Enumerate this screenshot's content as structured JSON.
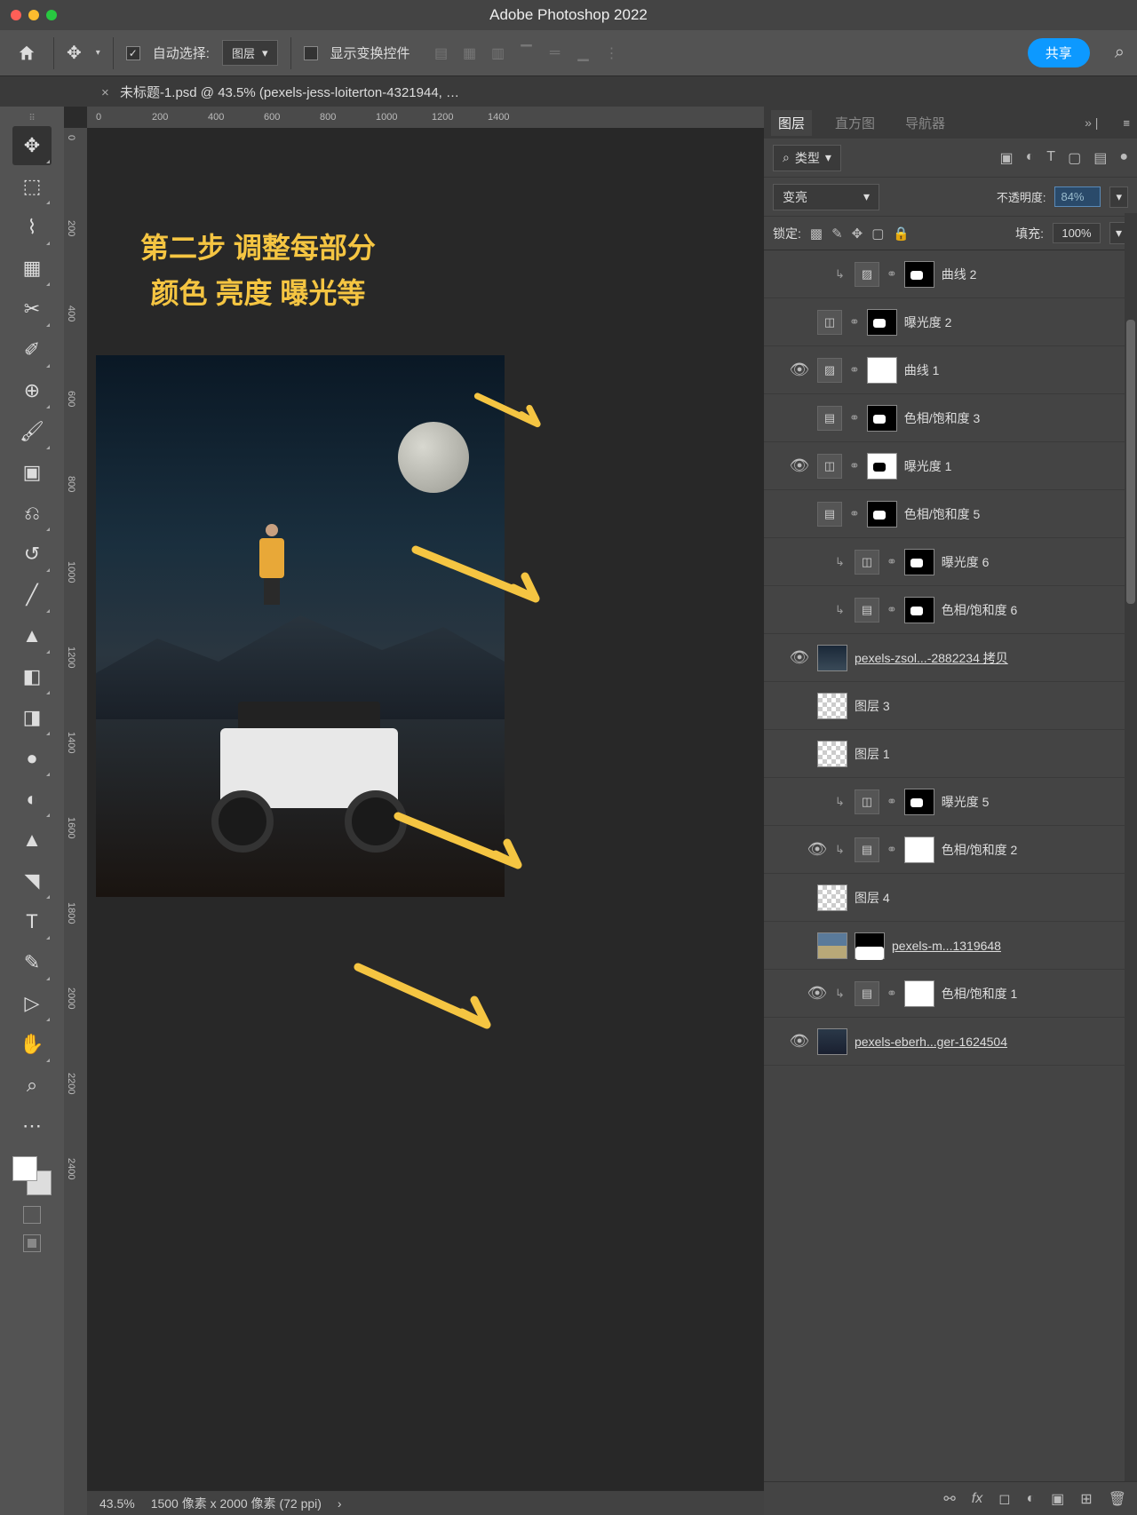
{
  "app": {
    "title": "Adobe Photoshop 2022"
  },
  "options": {
    "auto_select_label": "自动选择:",
    "auto_select_value": "图层",
    "transform_controls_label": "显示变换控件",
    "share_label": "共享"
  },
  "document": {
    "tab_title": "未标题-1.psd @ 43.5% (pexels-jess-loiterton-4321944, …"
  },
  "ruler_h": [
    "0",
    "200",
    "400",
    "600",
    "800",
    "1000",
    "1200",
    "1400"
  ],
  "ruler_v": [
    "0",
    "200",
    "400",
    "600",
    "800",
    "1000",
    "1200",
    "1400",
    "1600",
    "1800",
    "2000",
    "2200",
    "2400"
  ],
  "annotation": {
    "line1": "第二步 调整每部分",
    "line2": "颜色 亮度 曝光等"
  },
  "status": {
    "zoom": "43.5%",
    "dims": "1500 像素 x 2000 像素 (72 ppi)"
  },
  "panels": {
    "tabs": [
      "图层",
      "直方图",
      "导航器"
    ],
    "filter_label": "类型",
    "blend_mode": "变亮",
    "opacity_label": "不透明度:",
    "opacity_value": "84%",
    "lock_label": "锁定:",
    "fill_label": "填充:",
    "fill_value": "100%"
  },
  "layers": [
    {
      "vis": false,
      "indent": 2,
      "clip": true,
      "adj": "curves",
      "mask": "black-blob",
      "name": "曲线 2"
    },
    {
      "vis": false,
      "indent": 1,
      "clip": false,
      "adj": "exposure",
      "mask": "black-blob",
      "name": "曝光度 2"
    },
    {
      "vis": true,
      "indent": 1,
      "clip": false,
      "adj": "curves",
      "mask": "white",
      "name": "曲线 1"
    },
    {
      "vis": false,
      "indent": 1,
      "clip": false,
      "adj": "huesat",
      "mask": "black-blob",
      "name": "色相/饱和度 3"
    },
    {
      "vis": true,
      "indent": 1,
      "clip": false,
      "adj": "exposure",
      "mask": "white-blob",
      "name": "曝光度 1"
    },
    {
      "vis": false,
      "indent": 1,
      "clip": false,
      "adj": "huesat",
      "mask": "black-blob",
      "name": "色相/饱和度 5"
    },
    {
      "vis": false,
      "indent": 2,
      "clip": true,
      "adj": "exposure",
      "mask": "black-blob",
      "name": "曝光度 6"
    },
    {
      "vis": false,
      "indent": 2,
      "clip": true,
      "adj": "huesat",
      "mask": "black-blob",
      "name": "色相/饱和度 6"
    },
    {
      "vis": true,
      "indent": 1,
      "clip": false,
      "adj": null,
      "thumb": "img1",
      "mask": null,
      "name": "pexels-zsol...-2882234 拷贝",
      "linked": true
    },
    {
      "vis": false,
      "indent": 1,
      "clip": false,
      "adj": null,
      "thumb": "trans",
      "mask": null,
      "name": "图层 3"
    },
    {
      "vis": false,
      "indent": 1,
      "clip": false,
      "adj": null,
      "thumb": "trans",
      "mask": null,
      "name": "图层 1"
    },
    {
      "vis": false,
      "indent": 2,
      "clip": true,
      "adj": "exposure",
      "mask": "black-blob",
      "name": "曝光度 5"
    },
    {
      "vis": true,
      "indent": 2,
      "clip": true,
      "adj": "huesat",
      "mask": "white",
      "name": "色相/饱和度 2"
    },
    {
      "vis": false,
      "indent": 1,
      "clip": false,
      "adj": null,
      "thumb": "trans",
      "mask": null,
      "name": "图层 4"
    },
    {
      "vis": false,
      "indent": 1,
      "clip": false,
      "adj": null,
      "thumb": "img2",
      "mask": "black-half",
      "name": "pexels-m...1319648",
      "linked": true
    },
    {
      "vis": true,
      "indent": 2,
      "clip": true,
      "adj": "huesat",
      "mask": "white",
      "name": "色相/饱和度 1"
    },
    {
      "vis": true,
      "indent": 1,
      "clip": false,
      "adj": null,
      "thumb": "img3",
      "mask": null,
      "name": "pexels-eberh...ger-1624504",
      "linked": true
    }
  ],
  "footer_icons": [
    "link",
    "fx",
    "mask",
    "adj",
    "group",
    "new",
    "trash"
  ]
}
